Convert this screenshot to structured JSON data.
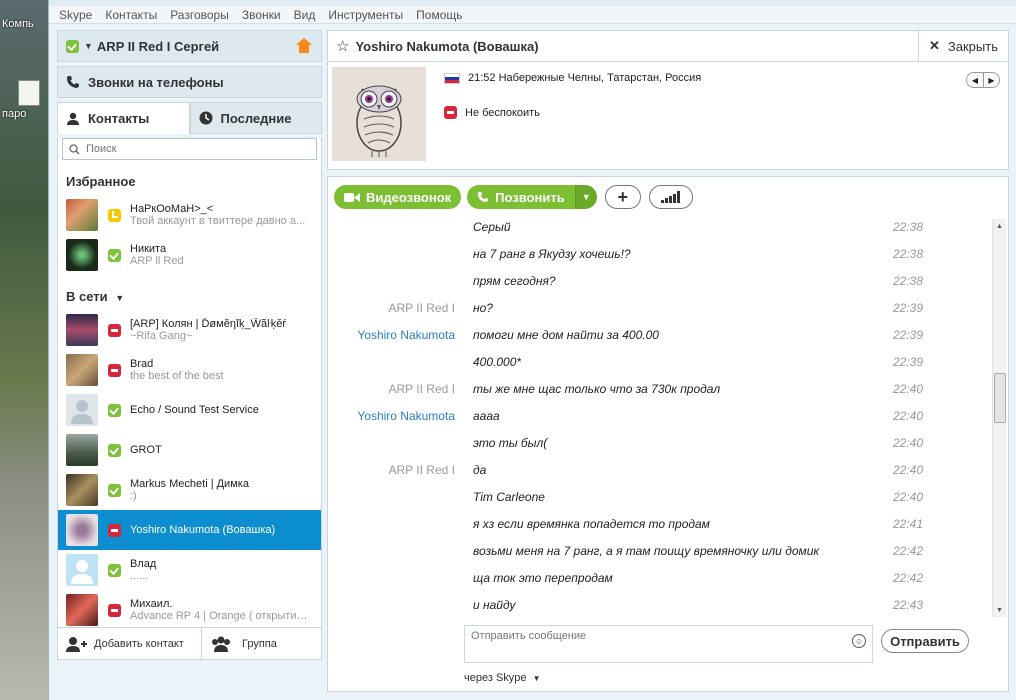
{
  "desktop": {
    "labels": [
      "Компь",
      "паро"
    ]
  },
  "menubar": {
    "items": [
      "Skype",
      "Контакты",
      "Разговоры",
      "Звонки",
      "Вид",
      "Инструменты",
      "Помощь"
    ]
  },
  "profile": {
    "name": "ARP II Red I Сергей",
    "status": "online"
  },
  "phones": {
    "label": "Звонки на телефоны"
  },
  "tabs": [
    {
      "label": "Контакты",
      "icon": "person-icon",
      "active": true
    },
    {
      "label": "Последние",
      "icon": "clock-icon",
      "active": false
    }
  ],
  "search": {
    "placeholder": "Поиск"
  },
  "favorites": {
    "title": "Избранное",
    "items": [
      {
        "name": "НаРкОоМаН>_<",
        "mood": "Твой аккаунт в твиттере давно а...",
        "status": "away"
      },
      {
        "name": "Никита",
        "mood": "ARP ll Red",
        "status": "online"
      }
    ]
  },
  "online": {
    "title": "В сети",
    "items": [
      {
        "name": "[ARP] Колян | Ďøмĕηĭķ_Ŵãŀķĕŕ",
        "mood": "~Rifa Gang~",
        "status": "dnd",
        "selected": false
      },
      {
        "name": "Brad",
        "mood": "the best of the best",
        "status": "dnd",
        "selected": false
      },
      {
        "name": "Echo / Sound Test Service",
        "mood": "",
        "status": "online",
        "selected": false
      },
      {
        "name": "GROT",
        "mood": "",
        "status": "online",
        "selected": false
      },
      {
        "name": "Markus Mecheti | Димка",
        "mood": ":)",
        "status": "online",
        "selected": false
      },
      {
        "name": "Yoshiro Nakumota (Вовашка)",
        "mood": "",
        "status": "dnd",
        "selected": true
      },
      {
        "name": "Влад",
        "mood": "......",
        "status": "online",
        "selected": false
      },
      {
        "name": "Михаил.",
        "mood": "Advance RP 4 | Orange ( открытие...",
        "status": "dnd",
        "selected": false
      }
    ]
  },
  "bottombar": {
    "add_contact": "Добавить контакт",
    "group": "Группа"
  },
  "chat": {
    "title": "Yoshiro Nakumota (Вовашка)",
    "close_label": "Закрыть",
    "location": "21:52 Набережные Челны, Татарстан, Россия",
    "status_text": "Не беспокоить",
    "video_call": "Видеозвонок",
    "call": "Позвонить",
    "composer_placeholder": "Отправить сообщение",
    "send": "Отправить",
    "via": "через Skype",
    "messages": [
      {
        "author": "",
        "text": "Серый",
        "time": "22:38",
        "them": false
      },
      {
        "author": "",
        "text": "на 7 ранг в Якудзу хочешь!?",
        "time": "22:38",
        "them": false
      },
      {
        "author": "",
        "text": "прям сегодня?",
        "time": "22:38",
        "them": false
      },
      {
        "author": "ARP II Red I",
        "text": "но?",
        "time": "22:39",
        "them": false
      },
      {
        "author": "Yoshiro Nakumota",
        "text": "помоги мне дом найти за 400.00",
        "time": "22:39",
        "them": true
      },
      {
        "author": "",
        "text": "400.000*",
        "time": "22:39",
        "them": true
      },
      {
        "author": "ARP II Red I",
        "text": " ты же мне щас только что за 730к продал",
        "time": "22:40",
        "them": false
      },
      {
        "author": "Yoshiro Nakumota",
        "text": "аааа",
        "time": "22:40",
        "them": true
      },
      {
        "author": "",
        "text": "это ты был(",
        "time": "22:40",
        "them": true
      },
      {
        "author": "ARP II Red I",
        "text": "да",
        "time": "22:40",
        "them": false
      },
      {
        "author": "",
        "text": "Tim Carleone",
        "time": "22:40",
        "them": false
      },
      {
        "author": "",
        "text": " я хз если времянка попадется то продам",
        "time": "22:41",
        "them": false
      },
      {
        "author": "",
        "text": "возьми меня на 7 ранг, а  я там  поищу времяночку или домик",
        "time": "22:42",
        "them": false
      },
      {
        "author": "",
        "text": "ща ток это перепродам",
        "time": "22:42",
        "them": false
      },
      {
        "author": "",
        "text": " и найду",
        "time": "22:43",
        "them": false
      }
    ]
  },
  "colors": {
    "accent_blue": "#0d8ed1",
    "green": "#7cbf33",
    "dnd_red": "#d6263a",
    "home_orange": "#f48a1a"
  }
}
